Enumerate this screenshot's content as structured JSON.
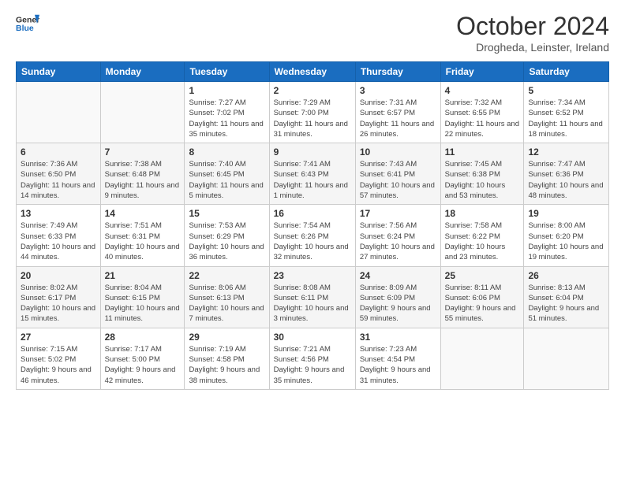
{
  "header": {
    "logo_line1": "General",
    "logo_line2": "Blue",
    "month": "October 2024",
    "location": "Drogheda, Leinster, Ireland"
  },
  "weekdays": [
    "Sunday",
    "Monday",
    "Tuesday",
    "Wednesday",
    "Thursday",
    "Friday",
    "Saturday"
  ],
  "weeks": [
    [
      {
        "day": "",
        "sunrise": "",
        "sunset": "",
        "daylight": ""
      },
      {
        "day": "",
        "sunrise": "",
        "sunset": "",
        "daylight": ""
      },
      {
        "day": "1",
        "sunrise": "Sunrise: 7:27 AM",
        "sunset": "Sunset: 7:02 PM",
        "daylight": "Daylight: 11 hours and 35 minutes."
      },
      {
        "day": "2",
        "sunrise": "Sunrise: 7:29 AM",
        "sunset": "Sunset: 7:00 PM",
        "daylight": "Daylight: 11 hours and 31 minutes."
      },
      {
        "day": "3",
        "sunrise": "Sunrise: 7:31 AM",
        "sunset": "Sunset: 6:57 PM",
        "daylight": "Daylight: 11 hours and 26 minutes."
      },
      {
        "day": "4",
        "sunrise": "Sunrise: 7:32 AM",
        "sunset": "Sunset: 6:55 PM",
        "daylight": "Daylight: 11 hours and 22 minutes."
      },
      {
        "day": "5",
        "sunrise": "Sunrise: 7:34 AM",
        "sunset": "Sunset: 6:52 PM",
        "daylight": "Daylight: 11 hours and 18 minutes."
      }
    ],
    [
      {
        "day": "6",
        "sunrise": "Sunrise: 7:36 AM",
        "sunset": "Sunset: 6:50 PM",
        "daylight": "Daylight: 11 hours and 14 minutes."
      },
      {
        "day": "7",
        "sunrise": "Sunrise: 7:38 AM",
        "sunset": "Sunset: 6:48 PM",
        "daylight": "Daylight: 11 hours and 9 minutes."
      },
      {
        "day": "8",
        "sunrise": "Sunrise: 7:40 AM",
        "sunset": "Sunset: 6:45 PM",
        "daylight": "Daylight: 11 hours and 5 minutes."
      },
      {
        "day": "9",
        "sunrise": "Sunrise: 7:41 AM",
        "sunset": "Sunset: 6:43 PM",
        "daylight": "Daylight: 11 hours and 1 minute."
      },
      {
        "day": "10",
        "sunrise": "Sunrise: 7:43 AM",
        "sunset": "Sunset: 6:41 PM",
        "daylight": "Daylight: 10 hours and 57 minutes."
      },
      {
        "day": "11",
        "sunrise": "Sunrise: 7:45 AM",
        "sunset": "Sunset: 6:38 PM",
        "daylight": "Daylight: 10 hours and 53 minutes."
      },
      {
        "day": "12",
        "sunrise": "Sunrise: 7:47 AM",
        "sunset": "Sunset: 6:36 PM",
        "daylight": "Daylight: 10 hours and 48 minutes."
      }
    ],
    [
      {
        "day": "13",
        "sunrise": "Sunrise: 7:49 AM",
        "sunset": "Sunset: 6:33 PM",
        "daylight": "Daylight: 10 hours and 44 minutes."
      },
      {
        "day": "14",
        "sunrise": "Sunrise: 7:51 AM",
        "sunset": "Sunset: 6:31 PM",
        "daylight": "Daylight: 10 hours and 40 minutes."
      },
      {
        "day": "15",
        "sunrise": "Sunrise: 7:53 AM",
        "sunset": "Sunset: 6:29 PM",
        "daylight": "Daylight: 10 hours and 36 minutes."
      },
      {
        "day": "16",
        "sunrise": "Sunrise: 7:54 AM",
        "sunset": "Sunset: 6:26 PM",
        "daylight": "Daylight: 10 hours and 32 minutes."
      },
      {
        "day": "17",
        "sunrise": "Sunrise: 7:56 AM",
        "sunset": "Sunset: 6:24 PM",
        "daylight": "Daylight: 10 hours and 27 minutes."
      },
      {
        "day": "18",
        "sunrise": "Sunrise: 7:58 AM",
        "sunset": "Sunset: 6:22 PM",
        "daylight": "Daylight: 10 hours and 23 minutes."
      },
      {
        "day": "19",
        "sunrise": "Sunrise: 8:00 AM",
        "sunset": "Sunset: 6:20 PM",
        "daylight": "Daylight: 10 hours and 19 minutes."
      }
    ],
    [
      {
        "day": "20",
        "sunrise": "Sunrise: 8:02 AM",
        "sunset": "Sunset: 6:17 PM",
        "daylight": "Daylight: 10 hours and 15 minutes."
      },
      {
        "day": "21",
        "sunrise": "Sunrise: 8:04 AM",
        "sunset": "Sunset: 6:15 PM",
        "daylight": "Daylight: 10 hours and 11 minutes."
      },
      {
        "day": "22",
        "sunrise": "Sunrise: 8:06 AM",
        "sunset": "Sunset: 6:13 PM",
        "daylight": "Daylight: 10 hours and 7 minutes."
      },
      {
        "day": "23",
        "sunrise": "Sunrise: 8:08 AM",
        "sunset": "Sunset: 6:11 PM",
        "daylight": "Daylight: 10 hours and 3 minutes."
      },
      {
        "day": "24",
        "sunrise": "Sunrise: 8:09 AM",
        "sunset": "Sunset: 6:09 PM",
        "daylight": "Daylight: 9 hours and 59 minutes."
      },
      {
        "day": "25",
        "sunrise": "Sunrise: 8:11 AM",
        "sunset": "Sunset: 6:06 PM",
        "daylight": "Daylight: 9 hours and 55 minutes."
      },
      {
        "day": "26",
        "sunrise": "Sunrise: 8:13 AM",
        "sunset": "Sunset: 6:04 PM",
        "daylight": "Daylight: 9 hours and 51 minutes."
      }
    ],
    [
      {
        "day": "27",
        "sunrise": "Sunrise: 7:15 AM",
        "sunset": "Sunset: 5:02 PM",
        "daylight": "Daylight: 9 hours and 46 minutes."
      },
      {
        "day": "28",
        "sunrise": "Sunrise: 7:17 AM",
        "sunset": "Sunset: 5:00 PM",
        "daylight": "Daylight: 9 hours and 42 minutes."
      },
      {
        "day": "29",
        "sunrise": "Sunrise: 7:19 AM",
        "sunset": "Sunset: 4:58 PM",
        "daylight": "Daylight: 9 hours and 38 minutes."
      },
      {
        "day": "30",
        "sunrise": "Sunrise: 7:21 AM",
        "sunset": "Sunset: 4:56 PM",
        "daylight": "Daylight: 9 hours and 35 minutes."
      },
      {
        "day": "31",
        "sunrise": "Sunrise: 7:23 AM",
        "sunset": "Sunset: 4:54 PM",
        "daylight": "Daylight: 9 hours and 31 minutes."
      },
      {
        "day": "",
        "sunrise": "",
        "sunset": "",
        "daylight": ""
      },
      {
        "day": "",
        "sunrise": "",
        "sunset": "",
        "daylight": ""
      }
    ]
  ]
}
